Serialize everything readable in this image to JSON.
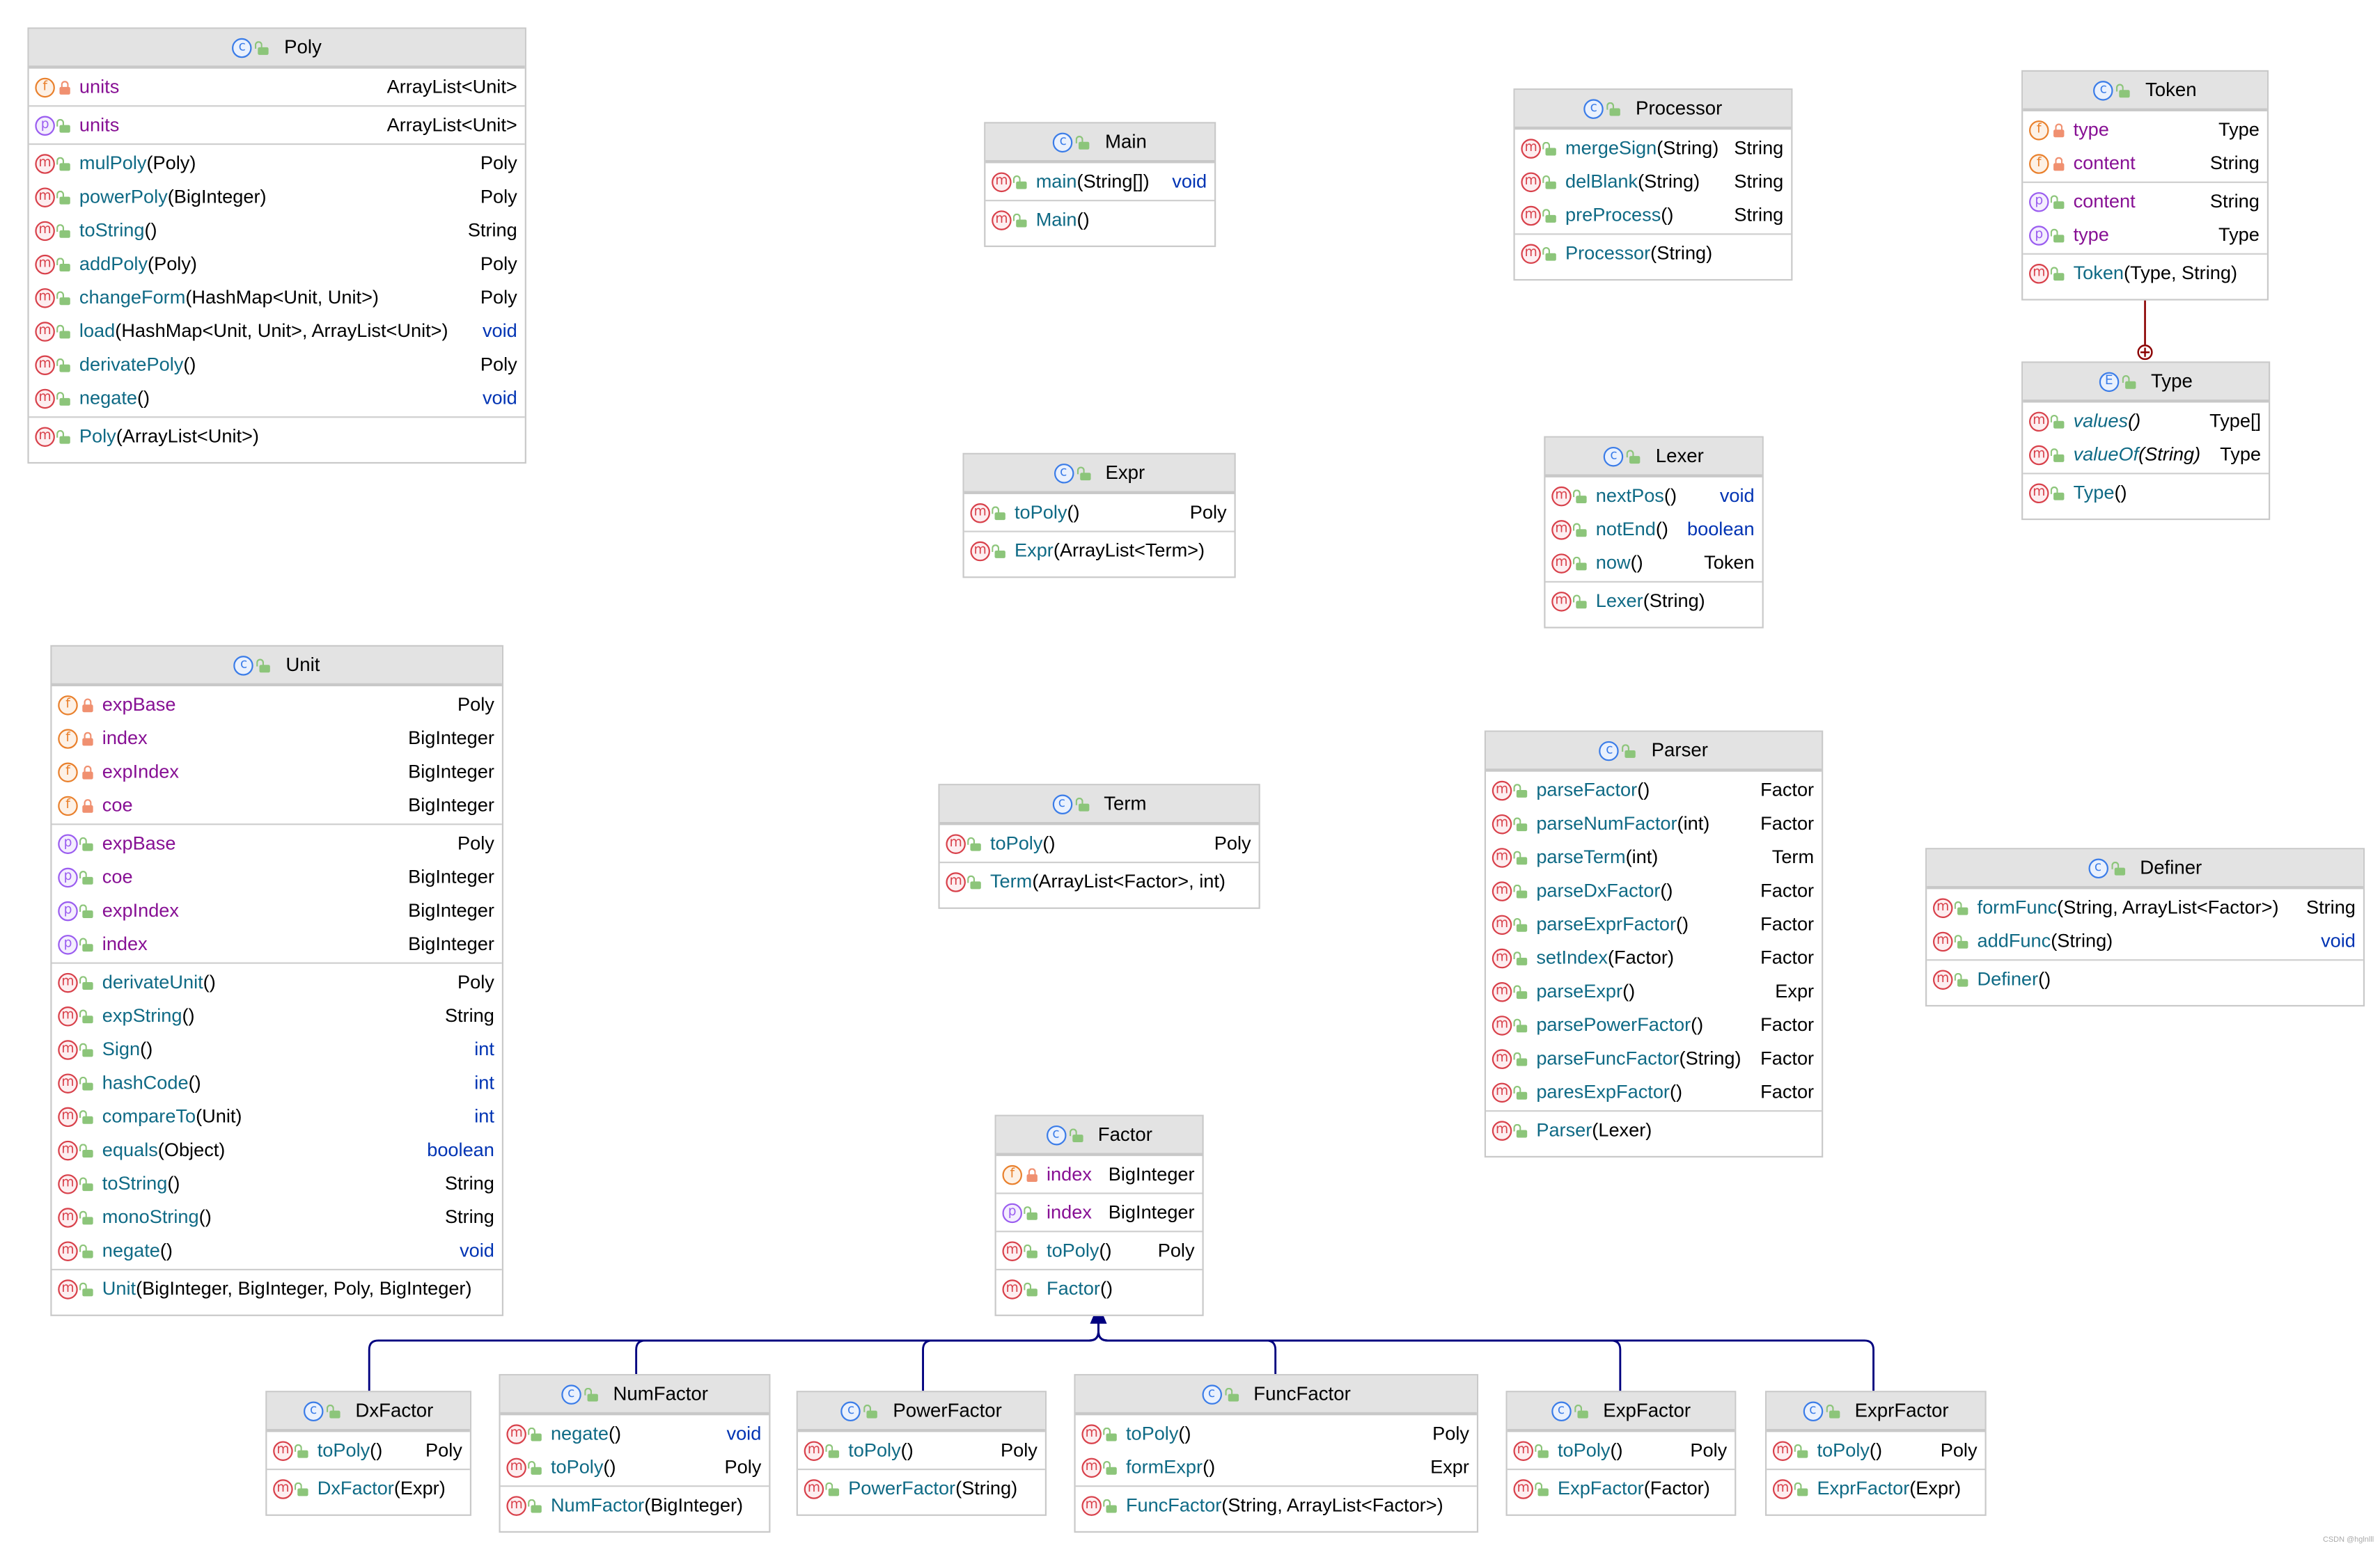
{
  "colors": {
    "inheritance": "#00007f",
    "inner_class": "#8b0000",
    "method": "#0f6a85",
    "field": "#871094",
    "keyword": "#0033b3",
    "header": "#e3e3e3"
  },
  "watermark": "CSDN @hglnlll",
  "classes": [
    {
      "name": "Poly",
      "kind": "class",
      "sections": [
        [
          {
            "k": "f",
            "v": "priv",
            "n": "units",
            "a": "",
            "t": "ArrayList<Unit>"
          }
        ],
        [
          {
            "k": "p",
            "v": "pub",
            "n": "units",
            "a": "",
            "t": "ArrayList<Unit>"
          }
        ],
        [
          {
            "k": "m",
            "v": "pub",
            "n": "mulPoly",
            "a": "(Poly)",
            "t": "Poly"
          },
          {
            "k": "m",
            "v": "pub",
            "n": "powerPoly",
            "a": "(BigInteger)",
            "t": "Poly"
          },
          {
            "k": "m",
            "v": "pub",
            "n": "toString",
            "a": "()",
            "t": "String"
          },
          {
            "k": "m",
            "v": "pub",
            "n": "addPoly",
            "a": "(Poly)",
            "t": "Poly"
          },
          {
            "k": "m",
            "v": "pub",
            "n": "changeForm",
            "a": "(HashMap<Unit, Unit>)",
            "t": "Poly"
          },
          {
            "k": "m",
            "v": "pub",
            "n": "load",
            "a": "(HashMap<Unit, Unit>, ArrayList<Unit>)",
            "t": "void"
          },
          {
            "k": "m",
            "v": "pub",
            "n": "derivatePoly",
            "a": "()",
            "t": "Poly"
          },
          {
            "k": "m",
            "v": "pub",
            "n": "negate",
            "a": "()",
            "t": "void"
          }
        ],
        [
          {
            "k": "m",
            "v": "pub",
            "n": "Poly",
            "a": "(ArrayList<Unit>)",
            "t": ""
          }
        ]
      ]
    },
    {
      "name": "Main",
      "kind": "class",
      "sections": [
        [
          {
            "k": "m",
            "v": "pub",
            "n": "main",
            "a": "(String[])",
            "t": "void"
          }
        ],
        [
          {
            "k": "m",
            "v": "pub",
            "n": "Main",
            "a": "()",
            "t": ""
          }
        ]
      ]
    },
    {
      "name": "Processor",
      "kind": "class",
      "sections": [
        [
          {
            "k": "m",
            "v": "pub",
            "n": "mergeSign",
            "a": "(String)",
            "t": "String"
          },
          {
            "k": "m",
            "v": "pub",
            "n": "delBlank",
            "a": "(String)",
            "t": "String"
          },
          {
            "k": "m",
            "v": "pub",
            "n": "preProcess",
            "a": "()",
            "t": "String"
          }
        ],
        [
          {
            "k": "m",
            "v": "pub",
            "n": "Processor",
            "a": "(String)",
            "t": ""
          }
        ]
      ]
    },
    {
      "name": "Token",
      "kind": "class",
      "sections": [
        [
          {
            "k": "f",
            "v": "priv",
            "n": "type",
            "a": "",
            "t": "Type"
          },
          {
            "k": "f",
            "v": "priv",
            "n": "content",
            "a": "",
            "t": "String"
          }
        ],
        [
          {
            "k": "p",
            "v": "pub",
            "n": "content",
            "a": "",
            "t": "String"
          },
          {
            "k": "p",
            "v": "pub",
            "n": "type",
            "a": "",
            "t": "Type"
          }
        ],
        [
          {
            "k": "m",
            "v": "pub",
            "n": "Token",
            "a": "(Type, String)",
            "t": ""
          }
        ]
      ]
    },
    {
      "name": "Type",
      "kind": "enum",
      "sections": [
        [
          {
            "k": "m",
            "v": "pub",
            "n": "values",
            "a": "()",
            "t": "Type[]",
            "static": true
          },
          {
            "k": "m",
            "v": "pub",
            "n": "valueOf",
            "a": "(String)",
            "t": "Type",
            "static": true
          }
        ],
        [
          {
            "k": "m",
            "v": "pub",
            "n": "Type",
            "a": "()",
            "t": ""
          }
        ]
      ]
    },
    {
      "name": "Expr",
      "kind": "class",
      "sections": [
        [
          {
            "k": "m",
            "v": "pub",
            "n": "toPoly",
            "a": "()",
            "t": "Poly"
          }
        ],
        [
          {
            "k": "m",
            "v": "pub",
            "n": "Expr",
            "a": "(ArrayList<Term>)",
            "t": ""
          }
        ]
      ]
    },
    {
      "name": "Lexer",
      "kind": "class",
      "sections": [
        [
          {
            "k": "m",
            "v": "pub",
            "n": "nextPos",
            "a": "()",
            "t": "void"
          },
          {
            "k": "m",
            "v": "pub",
            "n": "notEnd",
            "a": "()",
            "t": "boolean"
          },
          {
            "k": "m",
            "v": "pub",
            "n": "now",
            "a": "()",
            "t": "Token"
          }
        ],
        [
          {
            "k": "m",
            "v": "pub",
            "n": "Lexer",
            "a": "(String)",
            "t": ""
          }
        ]
      ]
    },
    {
      "name": "Unit",
      "kind": "class",
      "sections": [
        [
          {
            "k": "f",
            "v": "priv",
            "n": "expBase",
            "a": "",
            "t": "Poly"
          },
          {
            "k": "f",
            "v": "priv",
            "n": "index",
            "a": "",
            "t": "BigInteger"
          },
          {
            "k": "f",
            "v": "priv",
            "n": "expIndex",
            "a": "",
            "t": "BigInteger"
          },
          {
            "k": "f",
            "v": "priv",
            "n": "coe",
            "a": "",
            "t": "BigInteger"
          }
        ],
        [
          {
            "k": "p",
            "v": "pub",
            "n": "expBase",
            "a": "",
            "t": "Poly"
          },
          {
            "k": "p",
            "v": "pub",
            "n": "coe",
            "a": "",
            "t": "BigInteger"
          },
          {
            "k": "p",
            "v": "pub",
            "n": "expIndex",
            "a": "",
            "t": "BigInteger"
          },
          {
            "k": "p",
            "v": "pub",
            "n": "index",
            "a": "",
            "t": "BigInteger"
          }
        ],
        [
          {
            "k": "m",
            "v": "pub",
            "n": "derivateUnit",
            "a": "()",
            "t": "Poly"
          },
          {
            "k": "m",
            "v": "pub",
            "n": "expString",
            "a": "()",
            "t": "String"
          },
          {
            "k": "m",
            "v": "pub",
            "n": "Sign",
            "a": "()",
            "t": "int"
          },
          {
            "k": "m",
            "v": "pub",
            "n": "hashCode",
            "a": "()",
            "t": "int"
          },
          {
            "k": "m",
            "v": "pub",
            "n": "compareTo",
            "a": "(Unit)",
            "t": "int"
          },
          {
            "k": "m",
            "v": "pub",
            "n": "equals",
            "a": "(Object)",
            "t": "boolean"
          },
          {
            "k": "m",
            "v": "pub",
            "n": "toString",
            "a": "()",
            "t": "String"
          },
          {
            "k": "m",
            "v": "pub",
            "n": "monoString",
            "a": "()",
            "t": "String"
          },
          {
            "k": "m",
            "v": "pub",
            "n": "negate",
            "a": "()",
            "t": "void"
          }
        ],
        [
          {
            "k": "m",
            "v": "pub",
            "n": "Unit",
            "a": "(BigInteger, BigInteger, Poly, BigInteger)",
            "t": ""
          }
        ]
      ]
    },
    {
      "name": "Term",
      "kind": "class",
      "sections": [
        [
          {
            "k": "m",
            "v": "pub",
            "n": "toPoly",
            "a": "()",
            "t": "Poly"
          }
        ],
        [
          {
            "k": "m",
            "v": "pub",
            "n": "Term",
            "a": "(ArrayList<Factor>, int)",
            "t": ""
          }
        ]
      ]
    },
    {
      "name": "Parser",
      "kind": "class",
      "sections": [
        [
          {
            "k": "m",
            "v": "pub",
            "n": "parseFactor",
            "a": "()",
            "t": "Factor"
          },
          {
            "k": "m",
            "v": "pub",
            "n": "parseNumFactor",
            "a": "(int)",
            "t": "Factor"
          },
          {
            "k": "m",
            "v": "pub",
            "n": "parseTerm",
            "a": "(int)",
            "t": "Term"
          },
          {
            "k": "m",
            "v": "pub",
            "n": "parseDxFactor",
            "a": "()",
            "t": "Factor"
          },
          {
            "k": "m",
            "v": "pub",
            "n": "parseExprFactor",
            "a": "()",
            "t": "Factor"
          },
          {
            "k": "m",
            "v": "pub",
            "n": "setIndex",
            "a": "(Factor)",
            "t": "Factor"
          },
          {
            "k": "m",
            "v": "pub",
            "n": "parseExpr",
            "a": "()",
            "t": "Expr"
          },
          {
            "k": "m",
            "v": "pub",
            "n": "parsePowerFactor",
            "a": "()",
            "t": "Factor"
          },
          {
            "k": "m",
            "v": "pub",
            "n": "parseFuncFactor",
            "a": "(String)",
            "t": "Factor"
          },
          {
            "k": "m",
            "v": "pub",
            "n": "paresExpFactor",
            "a": "()",
            "t": "Factor"
          }
        ],
        [
          {
            "k": "m",
            "v": "pub",
            "n": "Parser",
            "a": "(Lexer)",
            "t": ""
          }
        ]
      ]
    },
    {
      "name": "Definer",
      "kind": "class",
      "sections": [
        [
          {
            "k": "m",
            "v": "pub",
            "n": "formFunc",
            "a": "(String, ArrayList<Factor>)",
            "t": "String"
          },
          {
            "k": "m",
            "v": "pub",
            "n": "addFunc",
            "a": "(String)",
            "t": "void"
          }
        ],
        [
          {
            "k": "m",
            "v": "pub",
            "n": "Definer",
            "a": "()",
            "t": ""
          }
        ]
      ]
    },
    {
      "name": "Factor",
      "kind": "class",
      "sections": [
        [
          {
            "k": "f",
            "v": "priv",
            "n": "index",
            "a": "",
            "t": "BigInteger"
          }
        ],
        [
          {
            "k": "p",
            "v": "pub",
            "n": "index",
            "a": "",
            "t": "BigInteger"
          }
        ],
        [
          {
            "k": "m",
            "v": "pub",
            "n": "toPoly",
            "a": "()",
            "t": "Poly"
          }
        ],
        [
          {
            "k": "m",
            "v": "pub",
            "n": "Factor",
            "a": "()",
            "t": ""
          }
        ]
      ]
    },
    {
      "name": "DxFactor",
      "kind": "class",
      "sections": [
        [
          {
            "k": "m",
            "v": "pub",
            "n": "toPoly",
            "a": "()",
            "t": "Poly"
          }
        ],
        [
          {
            "k": "m",
            "v": "pub",
            "n": "DxFactor",
            "a": "(Expr)",
            "t": ""
          }
        ]
      ]
    },
    {
      "name": "NumFactor",
      "kind": "class",
      "sections": [
        [
          {
            "k": "m",
            "v": "pub",
            "n": "negate",
            "a": "()",
            "t": "void"
          },
          {
            "k": "m",
            "v": "pub",
            "n": "toPoly",
            "a": "()",
            "t": "Poly"
          }
        ],
        [
          {
            "k": "m",
            "v": "pub",
            "n": "NumFactor",
            "a": "(BigInteger)",
            "t": ""
          }
        ]
      ]
    },
    {
      "name": "PowerFactor",
      "kind": "class",
      "sections": [
        [
          {
            "k": "m",
            "v": "pub",
            "n": "toPoly",
            "a": "()",
            "t": "Poly"
          }
        ],
        [
          {
            "k": "m",
            "v": "pub",
            "n": "PowerFactor",
            "a": "(String)",
            "t": ""
          }
        ]
      ]
    },
    {
      "name": "FuncFactor",
      "kind": "class",
      "sections": [
        [
          {
            "k": "m",
            "v": "pub",
            "n": "toPoly",
            "a": "()",
            "t": "Poly"
          },
          {
            "k": "m",
            "v": "pub",
            "n": "formExpr",
            "a": "()",
            "t": "Expr"
          }
        ],
        [
          {
            "k": "m",
            "v": "pub",
            "n": "FuncFactor",
            "a": "(String, ArrayList<Factor>)",
            "t": ""
          }
        ]
      ]
    },
    {
      "name": "ExpFactor",
      "kind": "class",
      "sections": [
        [
          {
            "k": "m",
            "v": "pub",
            "n": "toPoly",
            "a": "()",
            "t": "Poly"
          }
        ],
        [
          {
            "k": "m",
            "v": "pub",
            "n": "ExpFactor",
            "a": "(Factor)",
            "t": ""
          }
        ]
      ]
    },
    {
      "name": "ExprFactor",
      "kind": "class",
      "sections": [
        [
          {
            "k": "m",
            "v": "pub",
            "n": "toPoly",
            "a": "()",
            "t": "Poly"
          }
        ],
        [
          {
            "k": "m",
            "v": "pub",
            "n": "ExprFactor",
            "a": "(Expr)",
            "t": ""
          }
        ]
      ]
    }
  ],
  "relations": [
    {
      "type": "inheritance",
      "from": [
        "DxFactor",
        "NumFactor",
        "PowerFactor",
        "FuncFactor",
        "ExpFactor",
        "ExprFactor"
      ],
      "to": "Factor"
    },
    {
      "type": "inner-class",
      "outer": "Token",
      "inner": "Type"
    }
  ]
}
